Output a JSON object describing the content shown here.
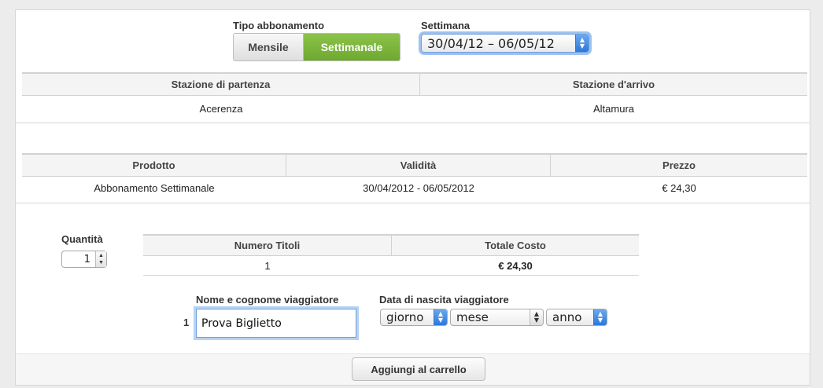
{
  "subscription_type": {
    "label": "Tipo abbonamento",
    "options": [
      "Mensile",
      "Settimanale"
    ],
    "selected": "Settimanale"
  },
  "week": {
    "label": "Settimana",
    "selected": "30/04/12 – 06/05/12"
  },
  "stations": {
    "headers": [
      "Stazione di partenza",
      "Stazione d'arrivo"
    ],
    "row": [
      "Acerenza",
      "Altamura"
    ]
  },
  "product": {
    "headers": [
      "Prodotto",
      "Validità",
      "Prezzo"
    ],
    "row": [
      "Abbonamento Settimanale",
      "30/04/2012 - 06/05/2012",
      "€ 24,30"
    ]
  },
  "quantity": {
    "label": "Quantità",
    "value": "1"
  },
  "totals": {
    "headers": [
      "Numero Titoli",
      "Totale Costo"
    ],
    "row": [
      "1",
      "€ 24,30"
    ]
  },
  "traveler": {
    "index": "1",
    "name_label": "Nome e cognome viaggiatore",
    "name_value": "Prova Biglietto",
    "birth_label": "Data di nascita viaggiatore",
    "day_placeholder": "giorno",
    "month_placeholder": "mese",
    "year_placeholder": "anno"
  },
  "add_to_cart_label": "Aggiungi al carrello",
  "colors": {
    "accent_green": "#7ab83c",
    "select_blue": "#2a78dc"
  }
}
